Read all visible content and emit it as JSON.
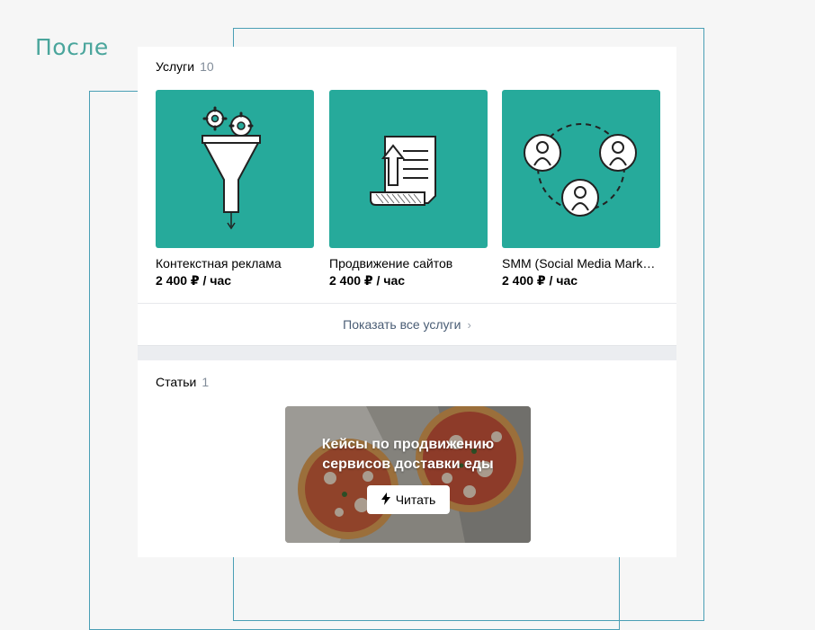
{
  "after_label": "После",
  "colors": {
    "teal": "#26aa9b",
    "guide_line": "#4a9fb5",
    "accent_text": "#4aa59c"
  },
  "services": {
    "heading": "Услуги",
    "count": "10",
    "items": [
      {
        "name": "Контекстная реклама",
        "price": "2 400 ₽ / час",
        "icon": "funnel-with-gears-icon"
      },
      {
        "name": "Продвижение сайтов",
        "price": "2 400 ₽ / час",
        "icon": "document-with-up-arrow-icon"
      },
      {
        "name": "SMM (Social Media Marketing)",
        "price": "2 400 ₽ / час",
        "icon": "people-circle-icon"
      }
    ],
    "show_all": "Показать все услуги"
  },
  "articles": {
    "heading": "Статьи",
    "count": "1",
    "card": {
      "title_line1": "Кейсы по продвижению",
      "title_line2": "сервисов доставки еды",
      "button": "Читать",
      "button_icon": "lightning-icon",
      "image": "pizza-photo"
    }
  }
}
